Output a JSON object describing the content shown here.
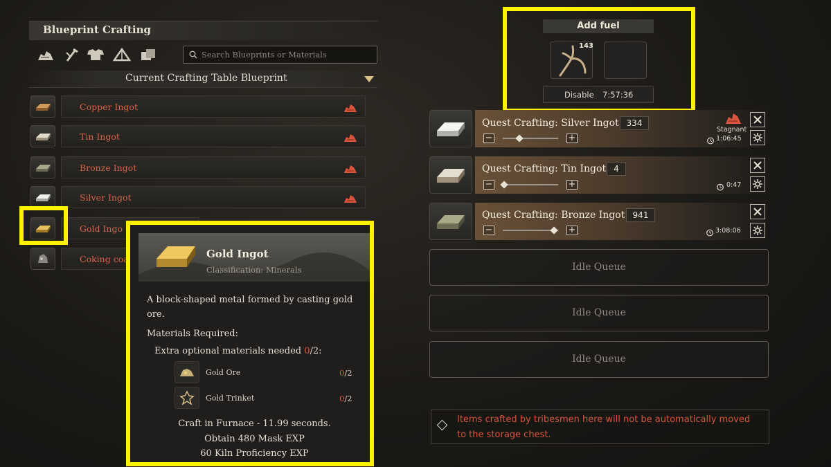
{
  "blueprint": {
    "title": "Blueprint Crafting",
    "categories": [
      "ore-pile-icon",
      "tools-icon",
      "armor-icon",
      "tent-icon",
      "box-icon"
    ],
    "search_placeholder": "Search Blueprints or Materials",
    "table_label": "Current Crafting Table Blueprint",
    "items": [
      {
        "label": "Copper Ingot",
        "icon": "copper-ingot-icon"
      },
      {
        "label": "Tin Ingot",
        "icon": "tin-ingot-icon"
      },
      {
        "label": "Bronze Ingot",
        "icon": "bronze-ingot-icon"
      },
      {
        "label": "Silver Ingot",
        "icon": "silver-ingot-icon"
      },
      {
        "label": "Gold Ingo",
        "icon": "gold-ingot-icon"
      },
      {
        "label": "Coking coa",
        "icon": "coal-icon"
      }
    ]
  },
  "tooltip": {
    "title": "Gold Ingot",
    "classification": "Classification: Minerals",
    "description": "A block-shaped metal formed by casting gold ore.",
    "materials_label": "Materials Required:",
    "extra_prefix": "Extra optional materials needed ",
    "extra_have": "0",
    "extra_need": "/2:",
    "materials": [
      {
        "name": "Gold Ore",
        "have": "0",
        "need": "/2"
      },
      {
        "name": "Gold Trinket",
        "have": "0",
        "need": "/2"
      }
    ],
    "craft_line": "Craft in Furnace - 11.99 seconds.",
    "exp_line": "Obtain 480 Mask EXP",
    "prof_line": "60 Kiln Proficiency EXP"
  },
  "fuel": {
    "title": "Add fuel",
    "count": "143",
    "disable_label": "Disable",
    "time": "7:57:36"
  },
  "queue": [
    {
      "title": "Quest Crafting: Silver Ingot",
      "count": "334",
      "timer": "1:06:45",
      "status": "Stagnant",
      "slider": 0.3
    },
    {
      "title": "Quest Crafting: Tin Ingot",
      "count": "4",
      "timer": "0:47",
      "status": "",
      "slider": 0.02
    },
    {
      "title": "Quest Crafting: Bronze Ingot",
      "count": "941",
      "timer": "3:08:06",
      "status": "",
      "slider": 0.92
    }
  ],
  "idle_label": "Idle Queue",
  "notice": "Items crafted by tribesmen here will not be automatically moved to the storage chest.",
  "colors": {
    "highlight": "#fff200",
    "accent_red": "#d9634a"
  }
}
